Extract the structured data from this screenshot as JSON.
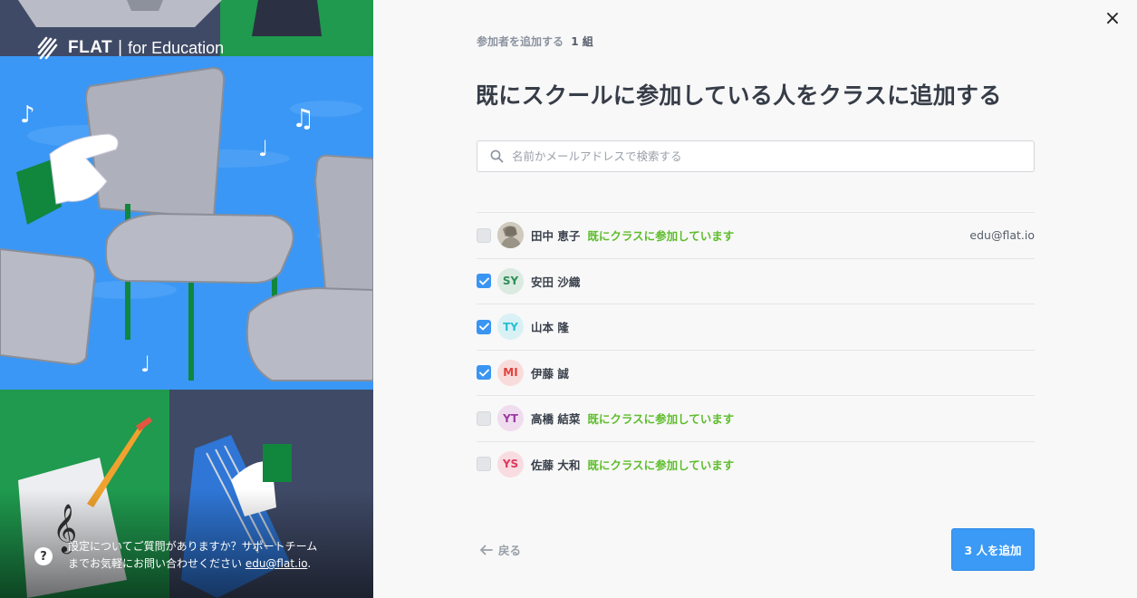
{
  "brand": {
    "name": "FLAT",
    "separator": "|",
    "sub": "for Education"
  },
  "help": {
    "line1": "設定についてご質問がありますか？サポートチーム",
    "line2_prefix": "までお気軽にお問い合わせください ",
    "email": "edu@flat.io",
    "line2_suffix": "."
  },
  "dialog": {
    "close_icon": "×",
    "step_label": "参加者を追加する",
    "step_count": "1 組",
    "title": "既にスクールに参加している人をクラスに追加する",
    "search": {
      "placeholder": "名前かメールアドレスで検索する",
      "value": ""
    },
    "members": [
      {
        "name": "田中 恵子",
        "initials": "",
        "avatar": "photo",
        "checked": false,
        "status": "既にクラスに参加しています",
        "email": "edu@flat.io",
        "color": "#9a9486",
        "bg": "#cfcabd"
      },
      {
        "name": "安田 沙織",
        "initials": "SY",
        "avatar": "initials",
        "checked": true,
        "status": "",
        "email": "",
        "color": "#2e8f57",
        "bg": "#dcebe2"
      },
      {
        "name": "山本 隆",
        "initials": "TY",
        "avatar": "initials",
        "checked": true,
        "status": "",
        "email": "",
        "color": "#27c0d4",
        "bg": "#d9f1f5"
      },
      {
        "name": "伊藤 誠",
        "initials": "MI",
        "avatar": "initials",
        "checked": true,
        "status": "",
        "email": "",
        "color": "#e2403c",
        "bg": "#f8dcdb"
      },
      {
        "name": "高橋 結菜",
        "initials": "YT",
        "avatar": "initials",
        "checked": false,
        "status": "既にクラスに参加しています",
        "email": "",
        "color": "#9c3aa2",
        "bg": "#f0dcef"
      },
      {
        "name": "佐藤 大和",
        "initials": "YS",
        "avatar": "initials",
        "checked": false,
        "status": "既にクラスに参加しています",
        "email": "",
        "color": "#e0385e",
        "bg": "#f8dce2"
      }
    ],
    "back_label": "戻る",
    "add_label": "3 人を追加"
  }
}
